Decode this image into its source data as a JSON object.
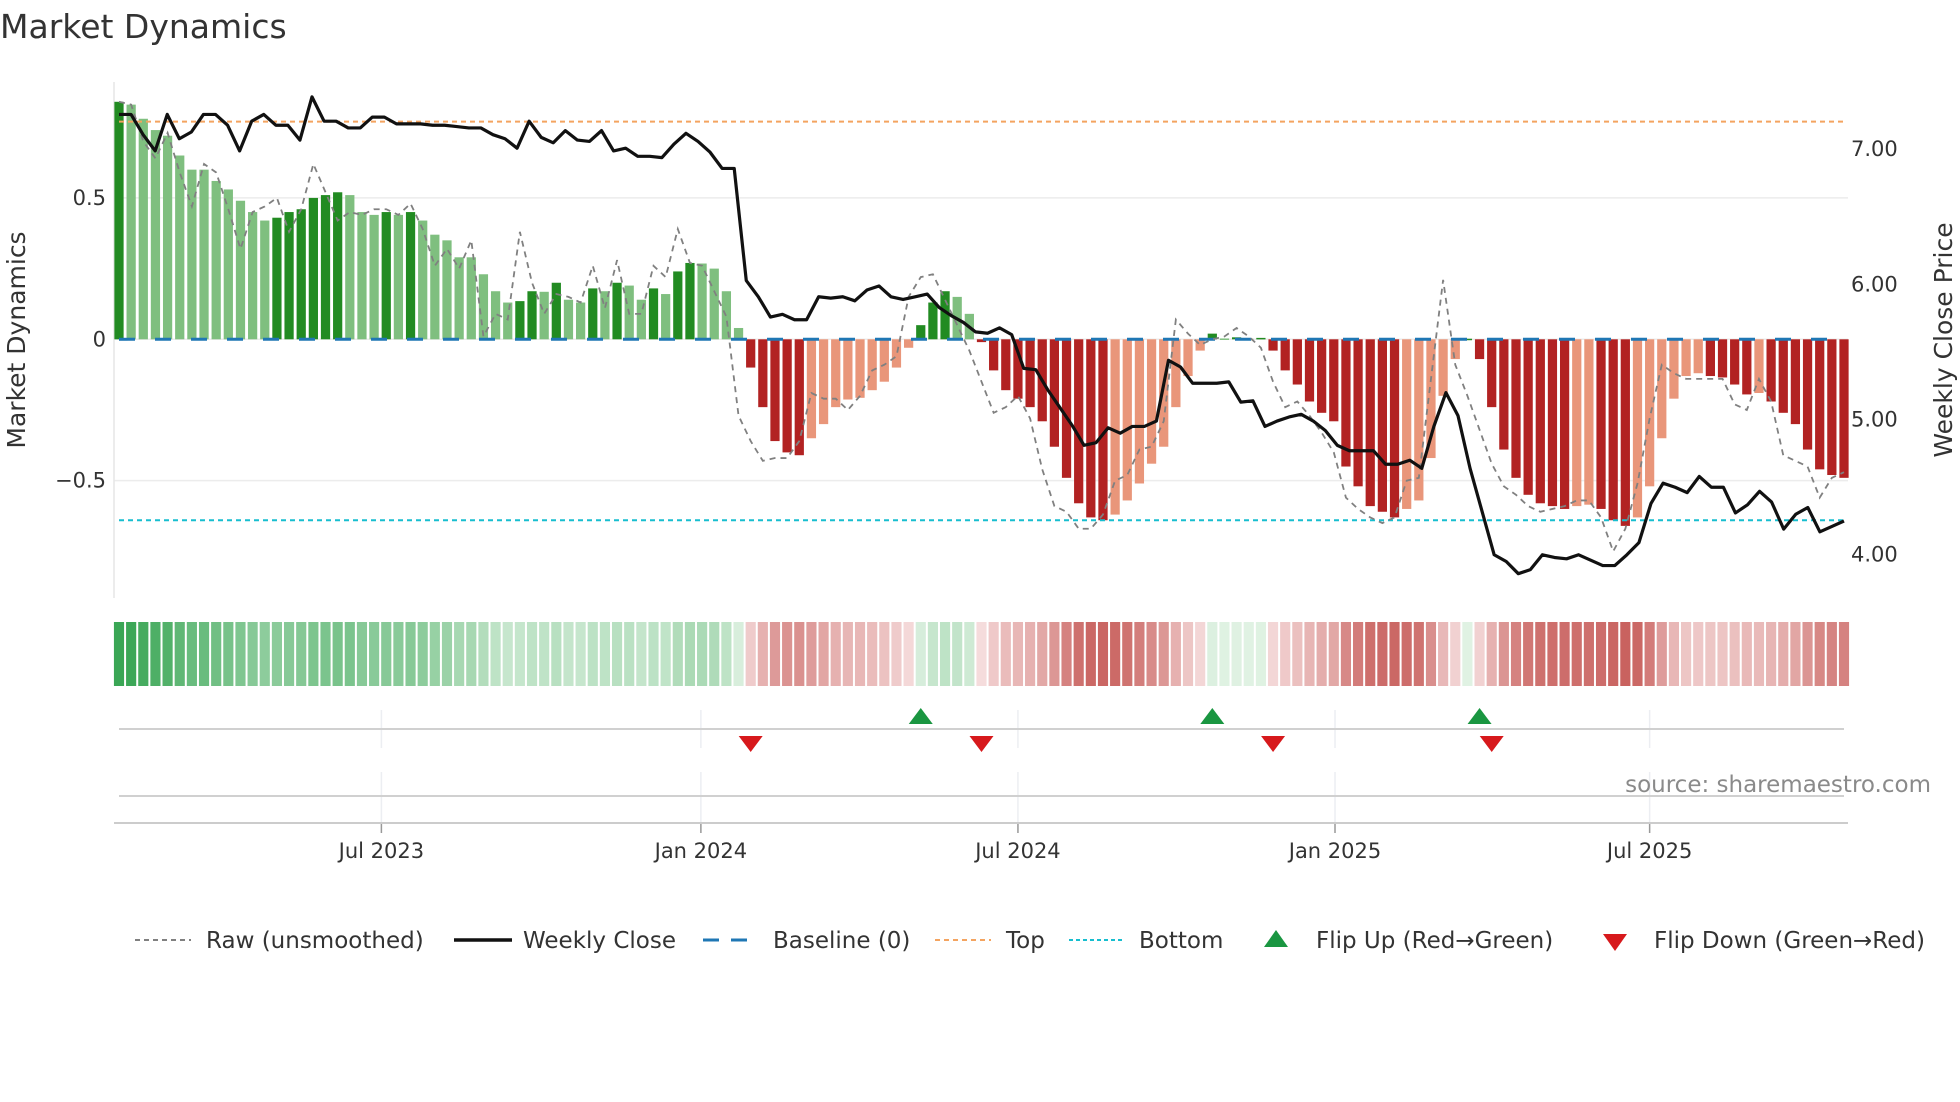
{
  "chart_data": {
    "type": "bar",
    "title": "Market Dynamics",
    "ylabel": "Market Dynamics",
    "y2label": "Weekly Close Price",
    "ylim": [
      -0.915,
      0.91
    ],
    "y2lim": [
      3.67,
      7.49
    ],
    "yticks": [
      {
        "v": 0.5,
        "label": "0.5"
      },
      {
        "v": 0,
        "label": "0"
      },
      {
        "v": -0.5,
        "label": "−0.5"
      }
    ],
    "y2ticks": [
      {
        "v": 7,
        "label": "7.00"
      },
      {
        "v": 6,
        "label": "6.00"
      },
      {
        "v": 5,
        "label": "5.00"
      },
      {
        "v": 4,
        "label": "4.00"
      }
    ],
    "xticks": [
      {
        "week": 21.6,
        "label": "Jul 2023"
      },
      {
        "week": 47.9,
        "label": "Jan 2024"
      },
      {
        "week": 74.0,
        "label": "Jul 2024"
      },
      {
        "week": 100.1,
        "label": "Jan 2025"
      },
      {
        "week": 126.0,
        "label": "Jul 2025"
      }
    ],
    "top_level": 0.77,
    "bottom_level": -0.64,
    "baseline": 0,
    "values": [
      0.84,
      0.83,
      0.78,
      0.74,
      0.72,
      0.65,
      0.6,
      0.6,
      0.56,
      0.53,
      0.49,
      0.45,
      0.42,
      0.43,
      0.45,
      0.46,
      0.5,
      0.51,
      0.52,
      0.51,
      0.45,
      0.44,
      0.45,
      0.44,
      0.45,
      0.42,
      0.37,
      0.35,
      0.29,
      0.29,
      0.23,
      0.17,
      0.13,
      0.135,
      0.17,
      0.168,
      0.2,
      0.14,
      0.13,
      0.18,
      0.17,
      0.2,
      0.19,
      0.14,
      0.18,
      0.16,
      0.24,
      0.27,
      0.268,
      0.25,
      0.17,
      0.04,
      -0.1,
      -0.24,
      -0.36,
      -0.4,
      -0.41,
      -0.35,
      -0.3,
      -0.24,
      -0.213,
      -0.207,
      -0.18,
      -0.15,
      -0.1,
      -0.03,
      0.05,
      0.13,
      0.17,
      0.15,
      0.09,
      -0.01,
      -0.11,
      -0.18,
      -0.21,
      -0.24,
      -0.29,
      -0.38,
      -0.49,
      -0.58,
      -0.63,
      -0.64,
      -0.62,
      -0.57,
      -0.51,
      -0.44,
      -0.38,
      -0.24,
      -0.13,
      -0.04,
      0.02,
      0.003,
      0.007,
      0.002,
      0.005,
      -0.04,
      -0.11,
      -0.16,
      -0.22,
      -0.26,
      -0.29,
      -0.45,
      -0.52,
      -0.59,
      -0.61,
      -0.63,
      -0.6,
      -0.57,
      -0.42,
      -0.2,
      -0.07,
      0.002,
      -0.07,
      -0.24,
      -0.39,
      -0.49,
      -0.55,
      -0.58,
      -0.59,
      -0.6,
      -0.59,
      -0.585,
      -0.6,
      -0.64,
      -0.66,
      -0.63,
      -0.52,
      -0.35,
      -0.21,
      -0.13,
      -0.12,
      -0.13,
      -0.135,
      -0.16,
      -0.195,
      -0.19,
      -0.22,
      -0.26,
      -0.3,
      -0.39,
      -0.46,
      -0.48,
      -0.49
    ],
    "raw": [
      0.84,
      0.83,
      0.7,
      0.64,
      0.73,
      0.59,
      0.47,
      0.62,
      0.59,
      0.46,
      0.32,
      0.45,
      0.47,
      0.5,
      0.38,
      0.46,
      0.62,
      0.52,
      0.42,
      0.45,
      0.44,
      0.46,
      0.46,
      0.44,
      0.48,
      0.39,
      0.26,
      0.32,
      0.25,
      0.35,
      0.01,
      0.09,
      0.07,
      0.38,
      0.2,
      0.09,
      0.16,
      0.15,
      0.13,
      0.26,
      0.11,
      0.28,
      0.09,
      0.09,
      0.26,
      0.22,
      0.39,
      0.27,
      0.26,
      0.17,
      0.08,
      -0.27,
      -0.36,
      -0.43,
      -0.42,
      -0.42,
      -0.36,
      -0.19,
      -0.21,
      -0.21,
      -0.25,
      -0.2,
      -0.11,
      -0.09,
      -0.06,
      0.15,
      0.22,
      0.23,
      0.14,
      0.05,
      -0.04,
      -0.15,
      -0.26,
      -0.24,
      -0.2,
      -0.28,
      -0.46,
      -0.59,
      -0.61,
      -0.67,
      -0.67,
      -0.62,
      -0.5,
      -0.48,
      -0.39,
      -0.38,
      -0.29,
      0.07,
      0.02,
      -0.02,
      0.0,
      0.01,
      0.04,
      0.01,
      -0.03,
      -0.15,
      -0.24,
      -0.22,
      -0.27,
      -0.33,
      -0.4,
      -0.56,
      -0.6,
      -0.63,
      -0.65,
      -0.63,
      -0.5,
      -0.49,
      -0.14,
      0.21,
      -0.09,
      -0.2,
      -0.32,
      -0.44,
      -0.52,
      -0.55,
      -0.59,
      -0.61,
      -0.6,
      -0.59,
      -0.57,
      -0.57,
      -0.63,
      -0.75,
      -0.67,
      -0.51,
      -0.28,
      -0.09,
      -0.12,
      -0.14,
      -0.14,
      -0.14,
      -0.14,
      -0.23,
      -0.25,
      -0.14,
      -0.22,
      -0.41,
      -0.43,
      -0.45,
      -0.56,
      -0.49,
      -0.47
    ],
    "close": [
      7.25,
      7.25,
      7.1,
      6.98,
      7.25,
      7.07,
      7.12,
      7.25,
      7.25,
      7.17,
      6.98,
      7.2,
      7.25,
      7.17,
      7.17,
      7.06,
      7.38,
      7.2,
      7.2,
      7.15,
      7.15,
      7.23,
      7.23,
      7.18,
      7.18,
      7.18,
      7.17,
      7.17,
      7.16,
      7.15,
      7.15,
      7.1,
      7.07,
      7.0,
      7.2,
      7.08,
      7.04,
      7.13,
      7.06,
      7.05,
      7.13,
      6.98,
      7.0,
      6.94,
      6.94,
      6.93,
      7.03,
      7.11,
      7.05,
      6.97,
      6.85,
      6.85,
      6.02,
      5.9,
      5.75,
      5.77,
      5.73,
      5.73,
      5.9,
      5.89,
      5.9,
      5.87,
      5.95,
      5.98,
      5.9,
      5.88,
      5.9,
      5.92,
      5.82,
      5.76,
      5.71,
      5.64,
      5.63,
      5.67,
      5.62,
      5.37,
      5.36,
      5.21,
      5.08,
      4.95,
      4.8,
      4.82,
      4.93,
      4.89,
      4.94,
      4.94,
      4.98,
      5.43,
      5.38,
      5.26,
      5.26,
      5.26,
      5.27,
      5.12,
      5.13,
      4.94,
      4.98,
      5.01,
      5.03,
      4.98,
      4.91,
      4.8,
      4.76,
      4.76,
      4.76,
      4.66,
      4.66,
      4.69,
      4.63,
      4.94,
      5.19,
      5.02,
      4.63,
      4.31,
      3.99,
      3.94,
      3.85,
      3.88,
      3.99,
      3.97,
      3.96,
      3.99,
      3.95,
      3.91,
      3.91,
      3.99,
      4.08,
      4.37,
      4.52,
      4.49,
      4.45,
      4.57,
      4.49,
      4.49,
      4.3,
      4.36,
      4.46,
      4.38,
      4.18,
      4.29,
      4.34,
      4.16,
      4.2,
      4.24
    ],
    "flip_up_weeks": [
      66,
      90,
      112
    ],
    "flip_down_weeks": [
      52,
      71,
      95,
      113
    ],
    "colors": {
      "pos_strong": "#228b22",
      "pos_weak": "#7fbf7f",
      "neg_strong": "#b22222",
      "neg_weak": "#e9967a",
      "close": "#111111",
      "raw": "#808080",
      "baseline": "#1f77b4",
      "top": "#f4a460",
      "bottom": "#17becf",
      "flip_up": "#1a9641",
      "flip_down": "#d7191c"
    },
    "legend": {
      "placement": "bottom",
      "items": [
        "Raw (unsmoothed)",
        "Weekly Close",
        "Baseline (0)",
        "Top",
        "Bottom",
        "Flip Up (Red→Green)",
        "Flip Down (Green→Red)"
      ]
    }
  },
  "source": "source: sharemaestro.com"
}
